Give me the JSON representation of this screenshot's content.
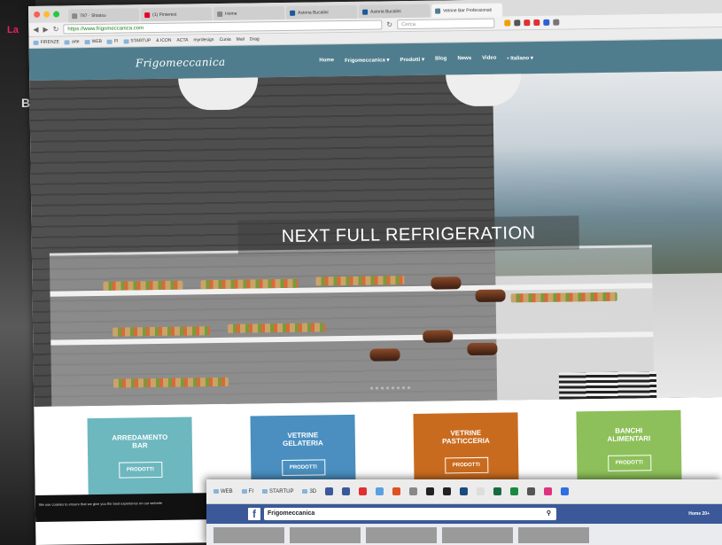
{
  "browser": {
    "tabs": [
      {
        "label": "787 · Shiatsu"
      },
      {
        "label": "(1) Pinterest"
      },
      {
        "label": "Home"
      },
      {
        "label": "Astoria Bucalini"
      },
      {
        "label": "Astoria Bucalini"
      },
      {
        "label": "Vetrine Bar Professionali",
        "active": true
      }
    ],
    "url": "https://www.frigomeccanica.com",
    "search_placeholder": "Cerca",
    "bookmarks": [
      "FIRENZE",
      "arte",
      "WEB",
      "FI",
      "STARTUP",
      "& ICON",
      "ACTA",
      "myrdesign",
      "Cuoia",
      "Mail",
      "Drag"
    ]
  },
  "site": {
    "logo": "Frigomeccanica",
    "menu": [
      "Home",
      "Frigomeccanica ▾",
      "Prodotti ▾",
      "Blog",
      "News",
      "Video",
      "▪ Italiano ▾"
    ],
    "hero_title": "NEXT FULL REFRIGERATION",
    "categories": [
      {
        "title": "ARREDAMENTO\nBAR",
        "button": "PRODOTTI",
        "color": "#6db7bf"
      },
      {
        "title": "VETRINE\nGELATERIA",
        "button": "PRODOTTI",
        "color": "#4a8fc0"
      },
      {
        "title": "VETRINE\nPASTICCERIA",
        "button": "PRODOTTI",
        "color": "#c96b1e"
      },
      {
        "title": "BANCHI\nALIMENTARI",
        "button": "PRODOTTI",
        "color": "#8dc05a"
      }
    ],
    "cookie_text": "We use cookies to ensure that we give you the best experience on our website"
  },
  "facebook": {
    "bookmarks": [
      "WEB",
      "FI",
      "STARTUP",
      "3D"
    ],
    "search_value": "Frigomeccanica",
    "home_label": "Home",
    "badge": "20+"
  },
  "behind": {
    "label1": "La",
    "label2": "B"
  },
  "colors": {
    "nav": "#4f7d8d",
    "fb": "#3b5998"
  }
}
